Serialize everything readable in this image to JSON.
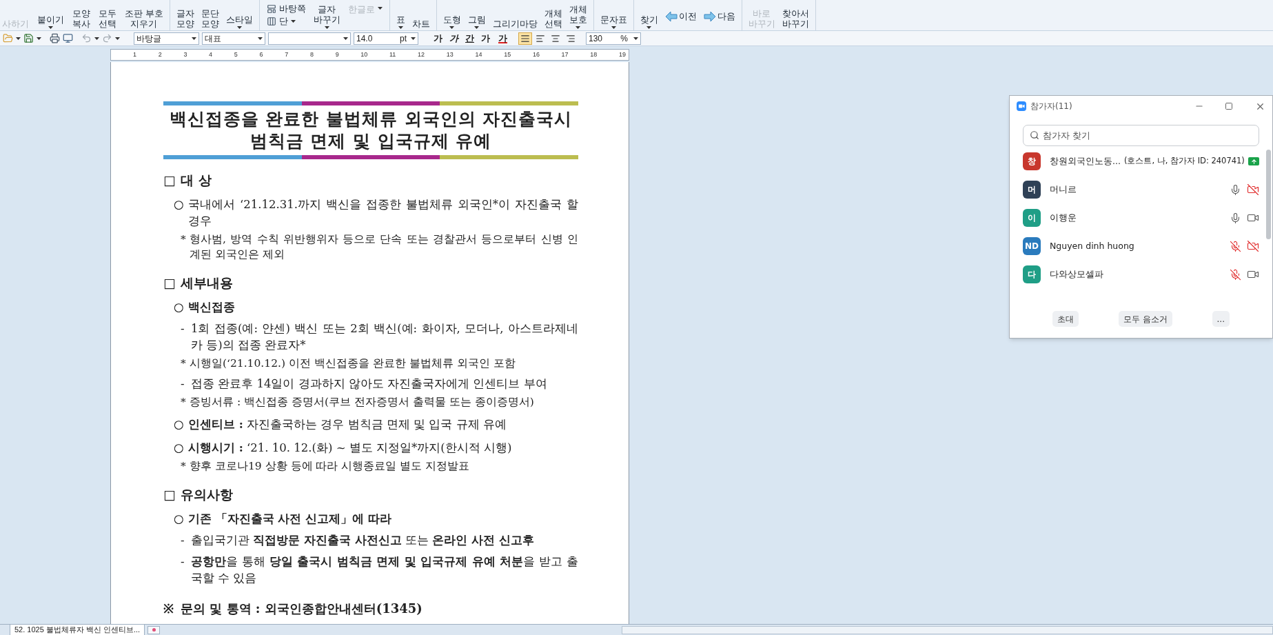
{
  "ribbon": {
    "groups": [
      [
        {
          "kind": "large",
          "lines": [
            "사하기"
          ],
          "caret": false,
          "disabled": true
        },
        {
          "kind": "large",
          "lines": [
            "붙이기"
          ],
          "caret": true,
          "disabled": false
        },
        {
          "kind": "large",
          "lines": [
            "모양",
            "복사"
          ],
          "caret": false,
          "disabled": false
        },
        {
          "kind": "large",
          "lines": [
            "모두",
            "선택"
          ],
          "caret": false,
          "disabled": false
        },
        {
          "kind": "large",
          "lines": [
            "조판 부호",
            "지우기"
          ],
          "caret": false,
          "disabled": false
        }
      ],
      [
        {
          "kind": "large",
          "lines": [
            "글자",
            "모양"
          ],
          "caret": false,
          "disabled": false
        },
        {
          "kind": "large",
          "lines": [
            "문단",
            "모양"
          ],
          "caret": false,
          "disabled": false
        },
        {
          "kind": "large",
          "lines": [
            "스타일"
          ],
          "caret": true,
          "disabled": false
        }
      ],
      [
        {
          "kind": "stack",
          "items": [
            {
              "label": "바탕쪽",
              "caret": false
            },
            {
              "label": "단",
              "caret": true
            }
          ]
        },
        {
          "kind": "large",
          "lines": [
            "글자",
            "바꾸기"
          ],
          "caret": true,
          "disabled": false
        },
        {
          "kind": "small",
          "lines": [
            "한글로"
          ],
          "caret": true,
          "disabled": true
        }
      ],
      [
        {
          "kind": "large",
          "lines": [
            "표"
          ],
          "caret": true,
          "disabled": false
        },
        {
          "kind": "large",
          "lines": [
            "차트"
          ],
          "caret": false,
          "disabled": false
        }
      ],
      [
        {
          "kind": "large",
          "lines": [
            "도형"
          ],
          "caret": true,
          "disabled": false
        },
        {
          "kind": "large",
          "lines": [
            "그림"
          ],
          "caret": true,
          "disabled": false
        },
        {
          "kind": "large",
          "lines": [
            "그리기마당"
          ],
          "caret": false,
          "disabled": false
        },
        {
          "kind": "large",
          "lines": [
            "개체",
            "선택"
          ],
          "caret": false,
          "disabled": false
        },
        {
          "kind": "large",
          "lines": [
            "개체",
            "보호"
          ],
          "caret": true,
          "disabled": false
        }
      ],
      [
        {
          "kind": "large",
          "lines": [
            "문자표"
          ],
          "caret": true,
          "disabled": false
        }
      ],
      [
        {
          "kind": "large",
          "lines": [
            "찾기"
          ],
          "caret": true,
          "disabled": false
        },
        {
          "kind": "previous",
          "lines": [
            "이전"
          ]
        },
        {
          "kind": "next",
          "lines": [
            "다음"
          ]
        }
      ],
      [
        {
          "kind": "large",
          "lines": [
            "바로",
            "바꾸기"
          ],
          "caret": false,
          "disabled": true
        },
        {
          "kind": "large",
          "lines": [
            "찾아서",
            "바꾸기"
          ],
          "caret": false,
          "disabled": false
        }
      ]
    ]
  },
  "toolbar": {
    "style": "바탕글",
    "language": "대표",
    "font_size": "14.0",
    "unit": "pt",
    "format_buttons": [
      {
        "kind": "bold",
        "label": "가"
      },
      {
        "kind": "italic",
        "label": "가"
      },
      {
        "kind": "underline",
        "label": "간"
      },
      {
        "kind": "spacing",
        "label": "가"
      },
      {
        "kind": "color",
        "label": "가"
      }
    ],
    "align": [
      {
        "kind": "justify",
        "selected": true
      },
      {
        "kind": "left",
        "selected": false
      },
      {
        "kind": "center",
        "selected": false
      },
      {
        "kind": "right",
        "selected": false
      }
    ],
    "zoom": "130",
    "zoom_unit": "%"
  },
  "ruler": {
    "marks": [
      "1",
      "2",
      "3",
      "4",
      "5",
      "6",
      "7",
      "8",
      "9",
      "10",
      "11",
      "12",
      "13",
      "14",
      "15",
      "16",
      "17",
      "18",
      "19"
    ]
  },
  "document": {
    "title_lines": [
      "백신접종을 완료한 불법체류 외국인의 자진출국시",
      "범칙금 면제 및 입국규제 유예"
    ],
    "title_rule": [
      {
        "color": "#4f9fd6"
      },
      {
        "color": "#a8288c"
      },
      {
        "color": "#bcbd50"
      }
    ],
    "blocks": [
      {
        "kind": "heading",
        "marker": "□",
        "text": "대 상",
        "bold": true
      },
      {
        "kind": "circle",
        "marker": "○",
        "text": "국내에서 ‘21.12.31.까지 백신을 접종한 불법체류 외국인*이 자진출국 할 경우",
        "bold": false
      },
      {
        "kind": "note",
        "marker": "*",
        "text": "형사범, 방역 수칙 위반행위자 등으로 단속 또는 경찰관서 등으로부터 신병 인계된 외국인은 제외",
        "bold": false
      },
      {
        "kind": "heading",
        "marker": "□",
        "text": "세부내용",
        "bold": true
      },
      {
        "kind": "circle",
        "marker": "○",
        "text": "백신접종",
        "bold": true
      },
      {
        "kind": "dash",
        "marker": "-",
        "text": "1회 접종(예: 얀센) 백신 또는 2회 백신(예: 화이자, 모더나, 아스트라제네카 등)의 접종 완료자*",
        "bold": false
      },
      {
        "kind": "note",
        "marker": "*",
        "text": "시행일(‘21.10.12.) 이전 백신접종을 완료한 불법체류 외국인 포함",
        "bold": false
      },
      {
        "kind": "dash",
        "marker": "-",
        "text": "접종 완료후 14일이 경과하지 않아도 자진출국자에게 인센티브 부여",
        "bold": false
      },
      {
        "kind": "note",
        "marker": "*",
        "text": "증빙서류 : 백신접종 증명서(쿠브 전자증명서 출력물 또는 종이증명서)",
        "bold": false
      },
      {
        "kind": "circle",
        "marker": "○",
        "text": "**인센티브 :** 자진출국하는 경우 범칙금 면제 및 입국 규제 유예",
        "bold": false
      },
      {
        "kind": "circle",
        "marker": "○",
        "text": "**시행시기 :** ‘21. 10. 12.(화) ~ 별도 지정일*까지(한시적 시행)",
        "bold": false
      },
      {
        "kind": "note",
        "marker": "*",
        "text": "향후 코로나19 상황 등에 따라 시행종료일 별도 지정발표",
        "bold": false
      },
      {
        "kind": "heading",
        "marker": "□",
        "text": "유의사항",
        "bold": true
      },
      {
        "kind": "circle",
        "marker": "○",
        "text": "기존 「자진출국 사전 신고제」에 따라",
        "bold": true
      },
      {
        "kind": "dash",
        "marker": "-",
        "text": "출입국기관 **직접방문 자진출국 사전신고** 또는 **온라인 사전 신고후**",
        "bold": false
      },
      {
        "kind": "dash",
        "marker": "-",
        "text": "**공항만**을 통해 **당일 출국시 범칙금 면제 및 입국규제 유예 처분**을 받고 출국할 수 있음",
        "bold": false
      },
      {
        "kind": "contact",
        "marker": "※",
        "text": "문의 및 통역 : 외국인종합안내센터(1345)",
        "bold": true
      }
    ]
  },
  "participants_window": {
    "title": "참가자(11)",
    "search": {
      "placeholder": "참가자 찾기"
    },
    "participants": [
      {
        "initial": "창",
        "color": "#c8372d",
        "name": "창원외국인노동...",
        "note": "(호스트, 나, 참가자 ID: 240741)",
        "sharing": true
      },
      {
        "initial": "머",
        "color": "#2f4156",
        "name": "머니르",
        "mic_muted": false,
        "video_on": false,
        "sharing": false
      },
      {
        "initial": "이",
        "color": "#1f9e86",
        "name": "이행운",
        "mic_muted": false,
        "video_on": true,
        "sharing": false
      },
      {
        "initial": "ND",
        "color": "#2a7bbd",
        "name": "Nguyen dinh huong",
        "mic_muted": true,
        "video_on": false,
        "sharing": false
      },
      {
        "initial": "다",
        "color": "#1f9e86",
        "name": "다와상모셀파",
        "mic_muted": true,
        "video_on": true,
        "sharing": false
      }
    ],
    "buttons": [
      "초대",
      "모두 음소거",
      "..."
    ]
  },
  "status_bar": {
    "document_tab": "52. 1025 불법체류자 백신 인센티브..."
  }
}
